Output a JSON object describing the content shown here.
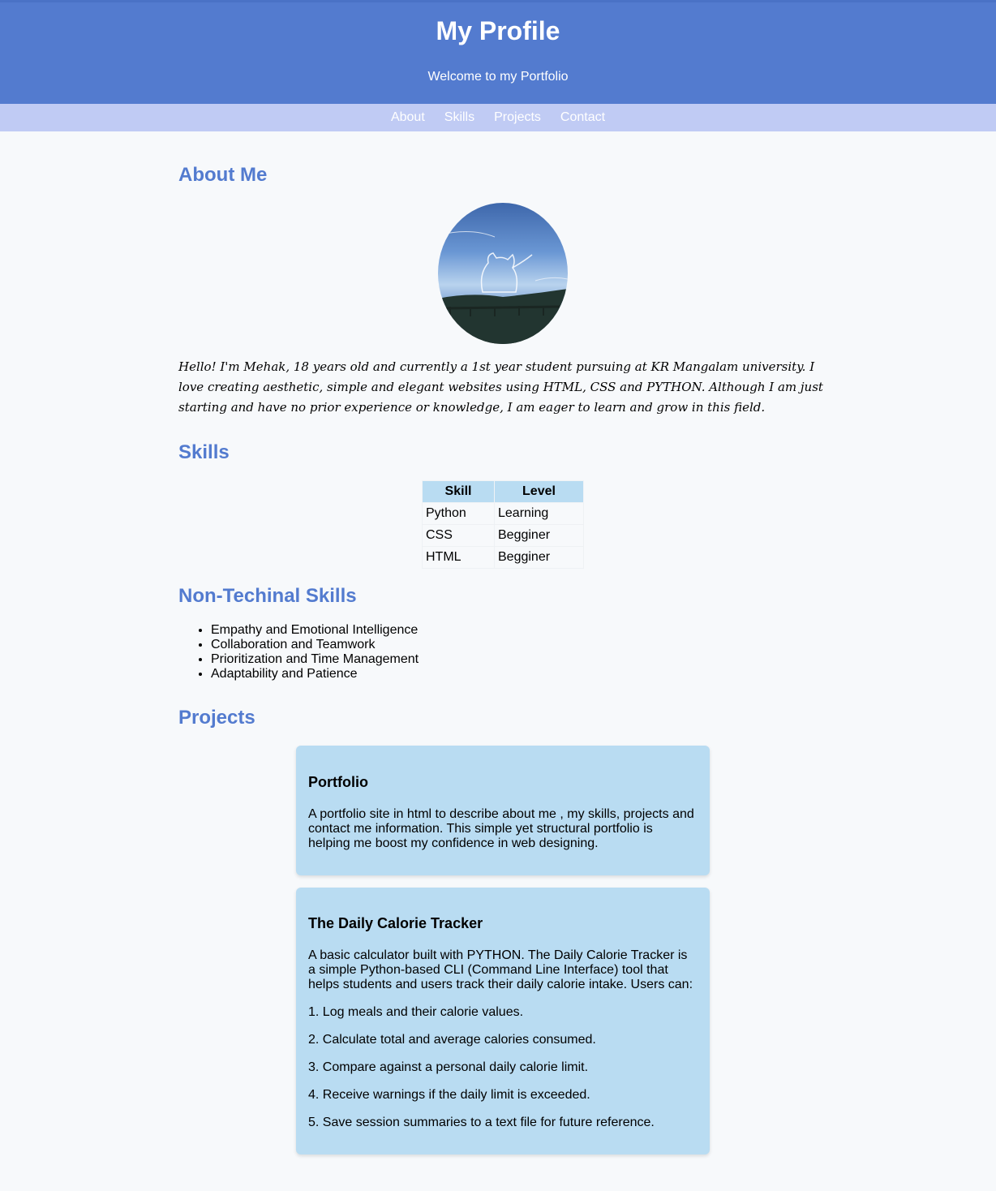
{
  "header": {
    "title": "My Profile",
    "subtitle": "Welcome to my Portfolio"
  },
  "nav": {
    "items": [
      "About",
      "Skills",
      "Projects",
      "Contact"
    ]
  },
  "about": {
    "title": "About Me",
    "bio": "Hello! I'm Mehak, 18 years old and currently a 1st year student pursuing at KR Mangalam university. I love creating aesthetic, simple and elegant websites using HTML, CSS and PYTHON. Although I am just starting and have no prior experience or knowledge, I am eager to learn and grow in this field."
  },
  "skills": {
    "title": "Skills",
    "headers": [
      "Skill",
      "Level"
    ],
    "rows": [
      [
        "Python",
        "Learning"
      ],
      [
        "CSS",
        "Begginer"
      ],
      [
        "HTML",
        "Begginer"
      ]
    ]
  },
  "nontech": {
    "title": "Non-Techinal Skills",
    "items": [
      "Empathy and Emotional Intelligence",
      "Collaboration and Teamwork",
      "Prioritization and Time Management",
      "Adaptability and Patience"
    ]
  },
  "projects": {
    "title": "Projects",
    "cards": [
      {
        "title": "Portfolio",
        "description": "A portfolio site in html to describe about me , my skills, projects and contact me information. This simple yet structural portfolio is helping me boost my confidence in web designing."
      },
      {
        "title": "The Daily Calorie Tracker",
        "description": "A basic calculator built with PYTHON. The Daily Calorie Tracker is a simple Python-based CLI (Command Line Interface) tool that helps students and users track their daily calorie intake. Users can:",
        "steps": [
          "1. Log meals and their calorie values.",
          "2. Calculate total and average calories consumed.",
          "3. Compare against a personal daily calorie limit.",
          "4. Receive warnings if the daily limit is exceeded.",
          "5. Save session summaries to a text file for future reference."
        ]
      }
    ]
  },
  "colors": {
    "header_bg": "#537bcf",
    "nav_bg": "#c0cbf4",
    "accent": "#537bcf",
    "card_bg": "#b9dcf2",
    "page_bg": "#f7f9fb"
  },
  "icons": {
    "avatar": "profile-photo-icon"
  }
}
